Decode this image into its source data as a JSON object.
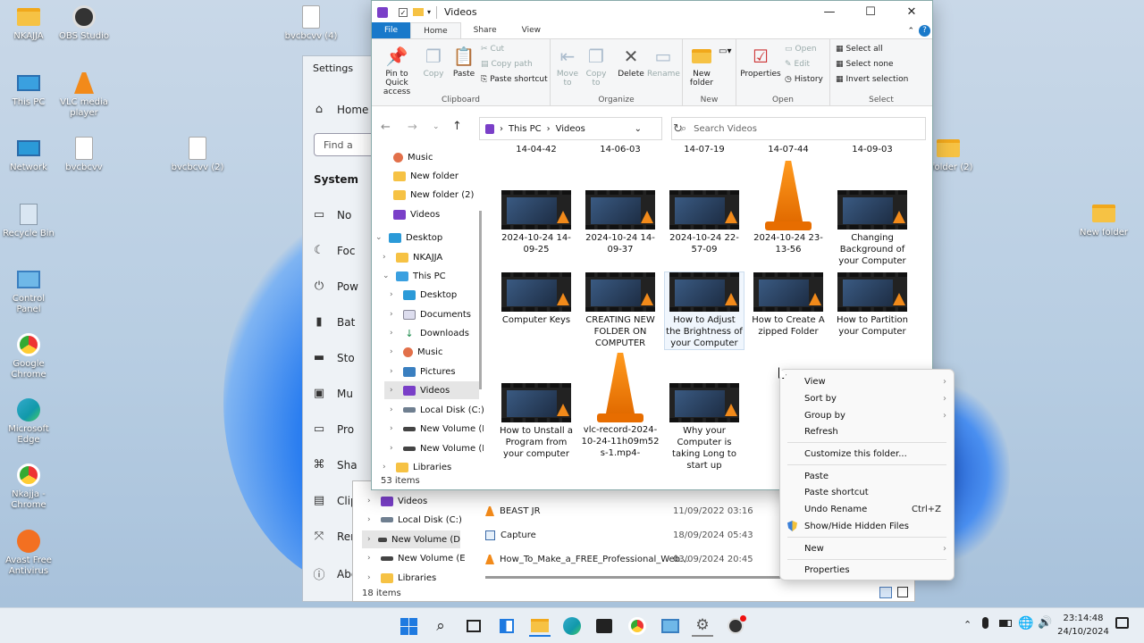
{
  "desktop": {
    "icons": [
      {
        "label": "NKAJJA"
      },
      {
        "label": "OBS Studio"
      },
      {
        "label": "bvcbcvv (4)"
      },
      {
        "label": "This PC"
      },
      {
        "label": "VLC media player"
      },
      {
        "label": "Network"
      },
      {
        "label": "bvcbcvv"
      },
      {
        "label": "bvcbcvv (2)"
      },
      {
        "label": "Recycle Bin"
      },
      {
        "label": "Control Panel"
      },
      {
        "label": "Google Chrome"
      },
      {
        "label": "Microsoft Edge"
      },
      {
        "label": "Nkajja - Chrome"
      },
      {
        "label": "Avast Free Antivirus"
      },
      {
        "label": "New folder"
      },
      {
        "label": "folder (2)"
      }
    ]
  },
  "settings": {
    "title": "Settings",
    "home": "Home",
    "find": "Find a",
    "system": "System",
    "items": [
      "No",
      "Foc",
      "Pow",
      "Bat",
      "Sto",
      "Mu",
      "Pro",
      "Sha",
      "Clip",
      "Rem",
      "Abo"
    ]
  },
  "explorer": {
    "title": "Videos",
    "tabs": {
      "file": "File",
      "home": "Home",
      "share": "Share",
      "view": "View"
    },
    "ribbon": {
      "pin": "Pin to Quick access",
      "copy": "Copy",
      "paste": "Paste",
      "cut": "Cut",
      "copy_path": "Copy path",
      "paste_shortcut": "Paste shortcut",
      "move_to": "Move to",
      "copy_to": "Copy to",
      "delete": "Delete",
      "rename": "Rename",
      "new_folder": "New folder",
      "properties": "Properties",
      "open": "Open",
      "edit": "Edit",
      "history": "History",
      "select_all": "Select all",
      "select_none": "Select none",
      "invert_selection": "Invert selection",
      "groups": {
        "clipboard": "Clipboard",
        "organize": "Organize",
        "new": "New",
        "open": "Open",
        "select": "Select"
      }
    },
    "address": {
      "this_pc": "This PC",
      "sep": "›",
      "videos": "Videos"
    },
    "search": {
      "placeholder": "Search Videos"
    },
    "nav": [
      "Music",
      "New folder",
      "New folder (2)",
      "Videos",
      "Desktop",
      "NKAJJA",
      "This PC",
      "Desktop",
      "Documents",
      "Downloads",
      "Music",
      "Pictures",
      "Videos",
      "Local Disk (C:)",
      "New Volume (D",
      "New Volume (E",
      "Libraries"
    ],
    "top_row": [
      "14-04-42",
      "14-06-03",
      "14-07-19",
      "14-07-44",
      "14-09-03"
    ],
    "files": [
      {
        "name": "2024-10-24 14-09-25",
        "kind": "video"
      },
      {
        "name": "2024-10-24 14-09-37",
        "kind": "video"
      },
      {
        "name": "2024-10-24 22-57-09",
        "kind": "video"
      },
      {
        "name": "2024-10-24 23-13-56",
        "kind": "vlc"
      },
      {
        "name": "Changing Background of your Computer",
        "kind": "video"
      },
      {
        "name": "Computer Keys",
        "kind": "video"
      },
      {
        "name": "CREATING NEW FOLDER ON COMPUTER",
        "kind": "video"
      },
      {
        "name": "How to Adjust the Brightness of your Computer",
        "kind": "video"
      },
      {
        "name": "How to Create A zipped Folder",
        "kind": "video"
      },
      {
        "name": "How to Partition your Computer",
        "kind": "video"
      },
      {
        "name": "How to Unstall a Program from your computer",
        "kind": "video"
      },
      {
        "name": "vlc-record-2024-10-24-11h09m52s-1.mp4-",
        "kind": "vlc"
      },
      {
        "name": "Why your Computer is taking Long to start up",
        "kind": "video"
      }
    ],
    "status": "53 items"
  },
  "back_explorer": {
    "nav": [
      "Videos",
      "Local Disk (C:)",
      "New Volume (D",
      "New Volume (E",
      "Libraries"
    ],
    "rows": [
      {
        "name": "BEAST JR",
        "date": "11/09/2022 03:16"
      },
      {
        "name": "Capture",
        "date": "18/09/2024 05:43"
      },
      {
        "name": "How_To_Make_a_FREE_Professional_Web...",
        "date": "03/09/2024 20:45"
      }
    ],
    "status": "18 items"
  },
  "context_menu": {
    "view": "View",
    "sort_by": "Sort by",
    "group_by": "Group by",
    "refresh": "Refresh",
    "customize": "Customize this folder...",
    "paste": "Paste",
    "paste_shortcut": "Paste shortcut",
    "undo_rename": "Undo Rename",
    "undo_shortcut": "Ctrl+Z",
    "show_hide": "Show/Hide Hidden Files",
    "new": "New",
    "properties": "Properties"
  },
  "taskbar": {
    "time": "23:14:48",
    "date": "24/10/2024"
  },
  "colors": {
    "accent": "#1979ca",
    "vlc": "#f28a1a",
    "folder": "#f6c244",
    "selection": "#e5e5e5"
  }
}
